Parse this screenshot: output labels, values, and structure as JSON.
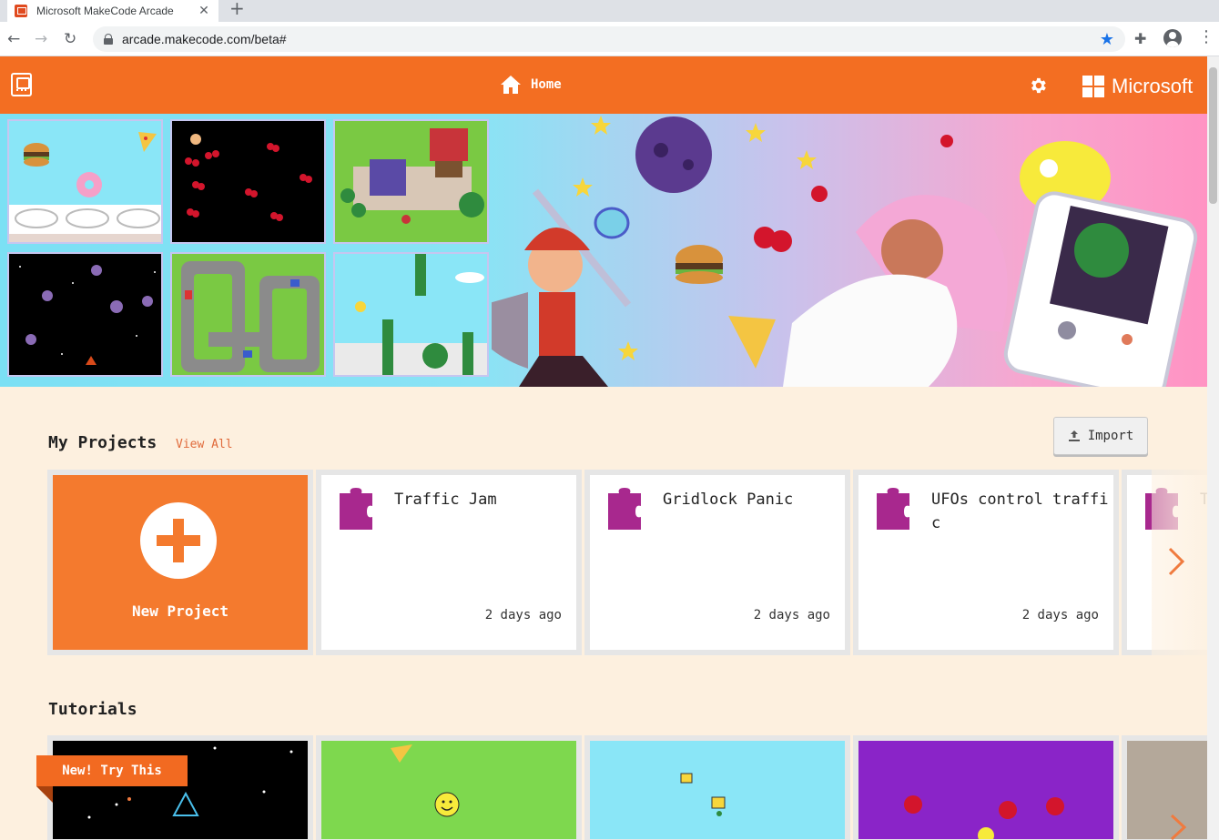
{
  "browser": {
    "tab_title": "Microsoft MakeCode Arcade",
    "tab_close": "✕",
    "new_tab": "+",
    "url": "arcade.makecode.com/beta#",
    "back": "←",
    "forward": "→",
    "reload": "↻",
    "bookmark_star": "★",
    "extensions_glyph": "✚",
    "menu_glyph": "⋮"
  },
  "header": {
    "home_label": "Home",
    "brand": "Microsoft",
    "accent": "#f36e22"
  },
  "my_projects": {
    "title": "My Projects",
    "view_all": "View All",
    "import_label": "Import",
    "new_project_label": "New Project",
    "projects": [
      {
        "title": "Traffic Jam",
        "date": "2 days ago"
      },
      {
        "title": "Gridlock Panic",
        "date": "2 days ago"
      },
      {
        "title": "UFOs control traffic",
        "date": "2 days ago"
      }
    ],
    "partial_card_letter": "T",
    "puzzle_color": "#a8288e"
  },
  "tutorials": {
    "title": "Tutorials",
    "badge": "New! Try This"
  }
}
